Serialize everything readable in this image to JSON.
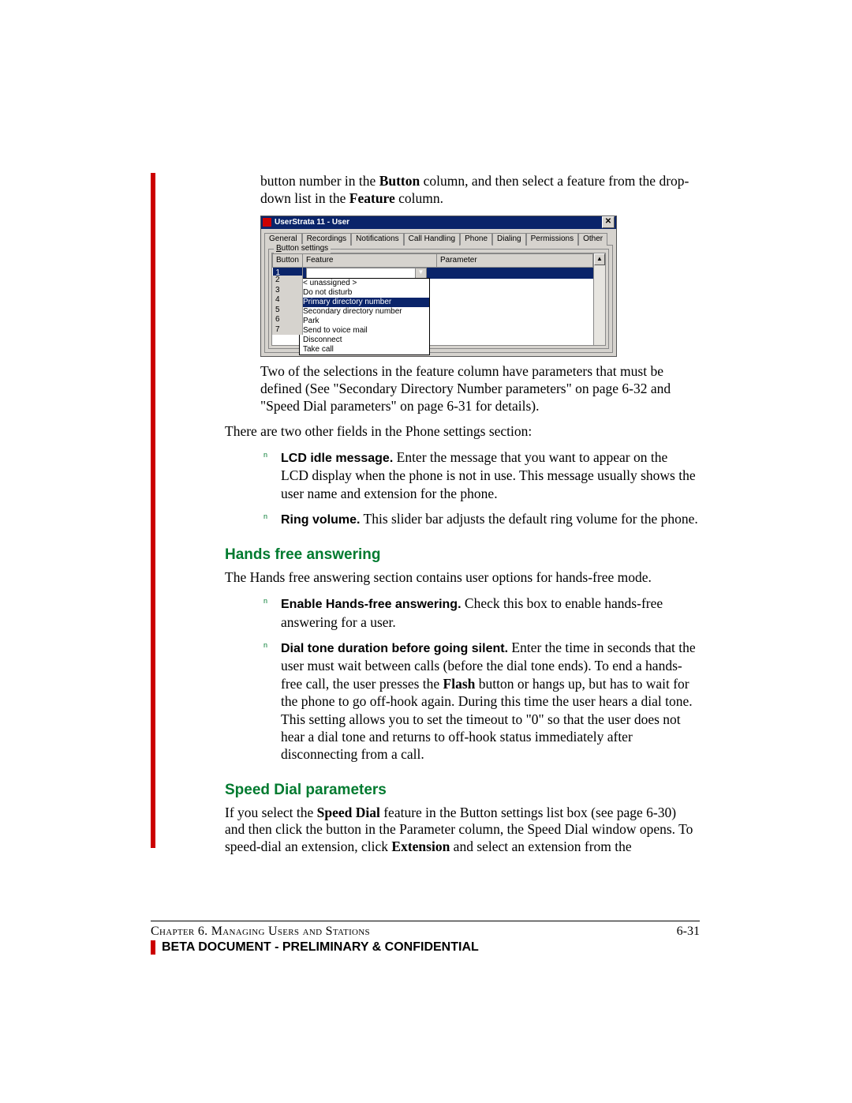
{
  "intro": {
    "p1a": "button number in the ",
    "p1_bold1": "Button",
    "p1b": " column, and then select a feature from the drop-down list in the ",
    "p1_bold2": "Feature",
    "p1c": " column."
  },
  "win": {
    "title": "UserStrata 11 - User",
    "close": "✕",
    "tabs": [
      "General",
      "Recordings",
      "Notifications",
      "Call Handling",
      "Phone",
      "Dialing",
      "Permissions",
      "Other"
    ],
    "active_tab": 4,
    "group_label": "Button settings",
    "cols": [
      "Button",
      "Feature",
      "Parameter"
    ],
    "selected_feature": "Primary directory number",
    "buttons": [
      "1",
      "2",
      "3",
      "4",
      "5",
      "6",
      "7"
    ],
    "dropdown": [
      "< unassigned >",
      "Do not disturb",
      "Primary directory number",
      "Secondary directory number",
      "Park",
      "Send to voice mail",
      "Disconnect",
      "Take call"
    ],
    "dropdown_hl": 2,
    "scroll_up": "▲",
    "scroll_dn": ""
  },
  "after_win": {
    "p": "Two of the selections in the feature column have parameters that must be defined (See \"Secondary Directory Number parameters\" on page 6-32 and \"Speed Dial parameters\" on page 6-31 for details)."
  },
  "two_other": "There are two other fields in the Phone settings section:",
  "bul1": {
    "bold": "LCD idle message.",
    "rest": " Enter the message that you want to appear on the LCD display when the phone is not in use. This message usually shows the user name and extension for the phone."
  },
  "bul2": {
    "bold": "Ring volume.",
    "rest": " This slider bar adjusts the default ring volume for the phone."
  },
  "h_hands": "Hands free answering",
  "hands_p": "The Hands free answering section contains user options for hands-free mode.",
  "bul3": {
    "bold": "Enable Hands-free answering.",
    "rest": " Check this box to enable hands-free answering for a user."
  },
  "bul4": {
    "bold": "Dial tone duration before going silent.",
    "rest_a": " Enter the time in seconds that the user must wait between calls (before the dial tone ends). To end a hands-free call, the user presses the ",
    "flash": "Flash",
    "rest_b": " button or hangs up, but has to wait for the phone to go off-hook again. During this time the user hears a dial tone. This setting allows you to set the timeout to \"0\" so that the user does not hear a dial tone and returns to off-hook status immediately after disconnecting from a call."
  },
  "h_speed": "Speed Dial parameters",
  "speed": {
    "a": "If you select the ",
    "sd": "Speed Dial",
    "b": " feature in the Button settings list box (see page 6-30) and then click the button in the Parameter column, the Speed Dial window opens. To speed-dial an extension, click ",
    "ext": "Extension",
    "c": " and select an extension from the"
  },
  "footer": {
    "chapter": "Chapter 6. Managing Users and Stations",
    "pageno": "6-31",
    "conf": "BETA DOCUMENT - PRELIMINARY & CONFIDENTIAL"
  }
}
